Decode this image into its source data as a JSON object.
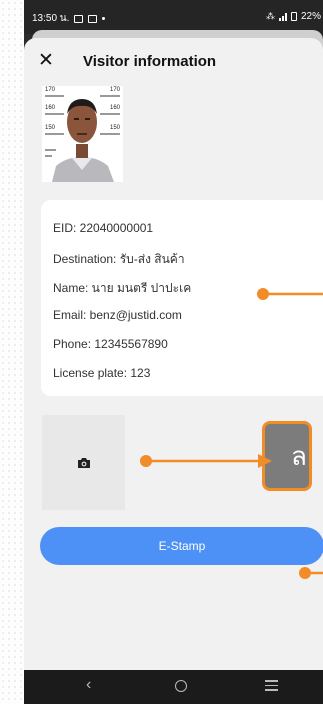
{
  "status_bar": {
    "time": "13:50 น.",
    "right_text": "22%"
  },
  "header": {
    "title": "Visitor information"
  },
  "visitor": {
    "lines": [
      "EID: 22040000001",
      "Destination: รับ-ส่ง สินค้า",
      "Name: นาย มนตรี ปาปะเค",
      "Email: benz@justid.com",
      "Phone: 12345567890",
      "License plate: 123"
    ],
    "mugshot_ruler_labels": [
      "170",
      "160",
      "150"
    ]
  },
  "actions": {
    "estamp_label": "E-Stamp"
  },
  "annotation": {
    "callout_text": "ล"
  },
  "icons": {
    "close": "close-icon",
    "camera": "camera-icon",
    "back": "nav-back-icon",
    "home": "nav-home-icon",
    "recents": "nav-recents-icon"
  },
  "colors": {
    "primary_button": "#4d91f7",
    "annotation_orange": "#f28c28",
    "sheet_bg": "#f1f1f1"
  }
}
